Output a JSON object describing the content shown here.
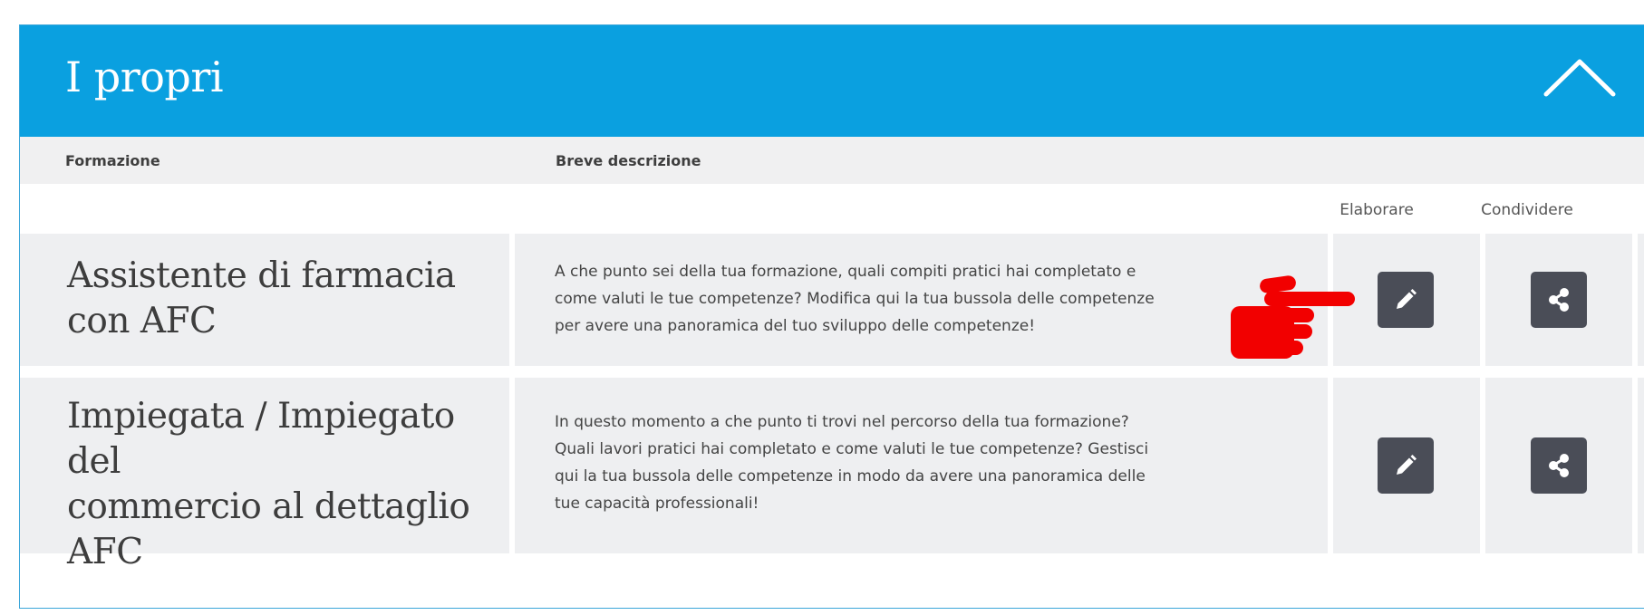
{
  "header": {
    "title": "I propri",
    "collapse_icon": "chevron-up-icon"
  },
  "columns": {
    "training": "Formazione",
    "description": "Breve descrizione"
  },
  "actions": {
    "edit_label": "Elaborare",
    "share_label": "Condividere",
    "edit_icon": "pencil-icon",
    "share_icon": "share-icon"
  },
  "rows": [
    {
      "title_lines": [
        "Assistente di farmacia",
        "con AFC"
      ],
      "description_lines": [
        "A che punto sei della tua formazione, quali compiti pratici hai completato e",
        "come valuti le tue competenze? Modifica qui la tua bussola delle competenze",
        "per avere una panoramica del tuo sviluppo delle competenze!"
      ]
    },
    {
      "title_lines": [
        "Impiegata / Impiegato del",
        "commercio al dettaglio",
        "AFC"
      ],
      "description_lines": [
        "In questo momento a che punto ti trovi nel percorso della tua formazione?",
        "Quali lavori pratici hai completato e come valuti le tue competenze? Gestisci",
        "qui la tua bussola delle competenze in modo da avere una panoramica delle",
        "tue capacità professionali!"
      ]
    }
  ],
  "colors": {
    "header_bg": "#0aa0e0",
    "row_bg": "#eeeff1",
    "button_bg": "#4a4d57",
    "pointer": "#f20000"
  }
}
